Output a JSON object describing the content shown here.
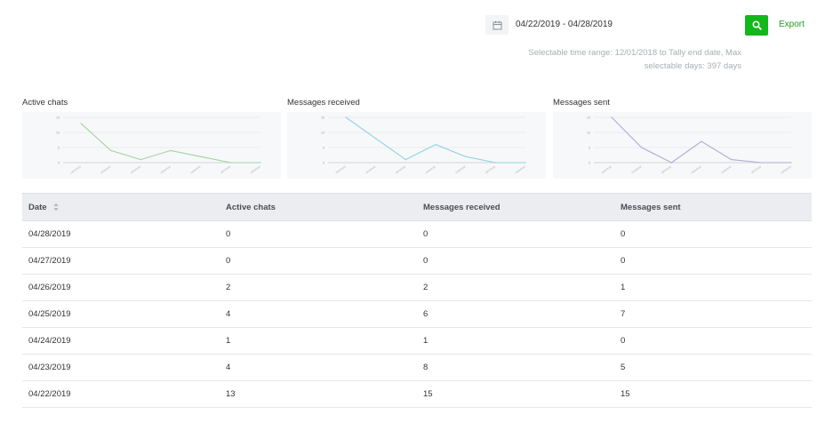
{
  "toolbar": {
    "date_range": "04/22/2019 - 04/28/2019",
    "export_label": "Export",
    "range_note_line1": "Selectable time range: 12/01/2018 to Tally end date, Max",
    "range_note_line2": "selectable days: 397 days",
    "calendar_icon": "calendar-icon",
    "search_icon": "search-icon",
    "accent_color": "#11b81a"
  },
  "charts": [
    {
      "title": "Active chats",
      "color": "#9fd39f"
    },
    {
      "title": "Messages received",
      "color": "#8fd3e3"
    },
    {
      "title": "Messages sent",
      "color": "#b3a7dc"
    }
  ],
  "chart_data": [
    {
      "type": "line",
      "title": "Active chats",
      "categories": [
        "04/22/2019",
        "04/23/2019",
        "04/24/2019",
        "04/25/2019",
        "04/26/2019",
        "04/27/2019",
        "04/28/2019"
      ],
      "values": [
        13,
        4,
        1,
        4,
        2,
        0,
        0
      ],
      "ylim": [
        0,
        15
      ],
      "yticks": [
        "0",
        "5",
        "10",
        "15"
      ]
    },
    {
      "type": "line",
      "title": "Messages received",
      "categories": [
        "04/22/2019",
        "04/23/2019",
        "04/24/2019",
        "04/25/2019",
        "04/26/2019",
        "04/27/2019",
        "04/28/2019"
      ],
      "values": [
        15,
        8,
        1,
        6,
        2,
        0,
        0
      ],
      "ylim": [
        0,
        15
      ],
      "yticks": [
        "0",
        "5",
        "10",
        "15"
      ]
    },
    {
      "type": "line",
      "title": "Messages sent",
      "categories": [
        "04/22/2019",
        "04/23/2019",
        "04/24/2019",
        "04/25/2019",
        "04/26/2019",
        "04/27/2019",
        "04/28/2019"
      ],
      "values": [
        15,
        5,
        0,
        7,
        1,
        0,
        0
      ],
      "ylim": [
        0,
        15
      ],
      "yticks": [
        "0",
        "5",
        "10",
        "15"
      ]
    }
  ],
  "table": {
    "headers": {
      "date": "Date",
      "active": "Active chats",
      "received": "Messages received",
      "sent": "Messages sent"
    },
    "rows": [
      {
        "date": "04/28/2019",
        "active": "0",
        "received": "0",
        "sent": "0"
      },
      {
        "date": "04/27/2019",
        "active": "0",
        "received": "0",
        "sent": "0"
      },
      {
        "date": "04/26/2019",
        "active": "2",
        "received": "2",
        "sent": "1"
      },
      {
        "date": "04/25/2019",
        "active": "4",
        "received": "6",
        "sent": "7"
      },
      {
        "date": "04/24/2019",
        "active": "1",
        "received": "1",
        "sent": "0"
      },
      {
        "date": "04/23/2019",
        "active": "4",
        "received": "8",
        "sent": "5"
      },
      {
        "date": "04/22/2019",
        "active": "13",
        "received": "15",
        "sent": "15"
      }
    ]
  }
}
